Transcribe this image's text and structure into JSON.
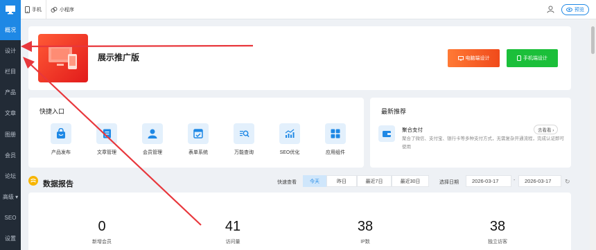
{
  "sidebar": {
    "logo_icon": "monitor-icon",
    "items": [
      {
        "label": "概况",
        "active": true
      },
      {
        "label": "设计"
      },
      {
        "label": "栏目"
      },
      {
        "label": "产品"
      },
      {
        "label": "文章"
      },
      {
        "label": "图册"
      },
      {
        "label": "会员"
      },
      {
        "label": "论坛"
      },
      {
        "label": "高级 ▾"
      },
      {
        "label": "SEO"
      },
      {
        "label": "设置"
      }
    ]
  },
  "topbar": {
    "mobile_label": "手机",
    "miniapp_label": "小程序",
    "preview_label": "预览"
  },
  "hero": {
    "title": "展示推广版",
    "pc_design_label": "电脑端设计",
    "mobile_design_label": "手机端设计"
  },
  "quick_entry": {
    "title": "快捷入口",
    "items": [
      {
        "label": "产品发布",
        "icon": "bag-icon"
      },
      {
        "label": "文章管理",
        "icon": "document-icon"
      },
      {
        "label": "会员管理",
        "icon": "user-icon"
      },
      {
        "label": "表单系统",
        "icon": "form-icon"
      },
      {
        "label": "万能查询",
        "icon": "search-doc-icon"
      },
      {
        "label": "SEO优化",
        "icon": "chart-up-icon"
      },
      {
        "label": "应用组件",
        "icon": "grid-icon"
      }
    ]
  },
  "recommended": {
    "title": "最新推荐",
    "item_name": "聚合支付",
    "more_label": "去看看 ›",
    "description": "聚合了微信、支付宝、银行卡等多种支付方式，无需复杂开通流程，完成认证即可使用"
  },
  "report": {
    "title": "数据报告",
    "quick_view_label": "快速查看",
    "ranges": [
      "今天",
      "昨日",
      "最近7日",
      "最近30日"
    ],
    "active_range": "今天",
    "date_label": "选择日期",
    "date_from": "2026-03-17",
    "date_sep": "-",
    "date_to": "2026-03-17",
    "stats": [
      {
        "value": "0",
        "label": "新增会员"
      },
      {
        "value": "41",
        "label": "访问量"
      },
      {
        "value": "38",
        "label": "IP数"
      },
      {
        "value": "38",
        "label": "独立访客"
      }
    ]
  },
  "colors": {
    "accent": "#1e88e5",
    "sidebar_bg": "#222b36",
    "annotation_arrow": "#e8373c",
    "pc_button": "#f5561f",
    "mobile_button": "#1bbf3a"
  }
}
